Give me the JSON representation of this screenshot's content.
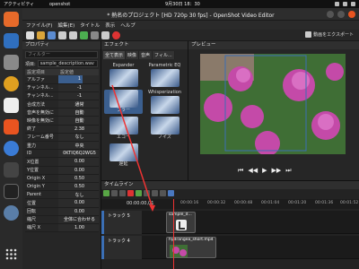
{
  "system": {
    "activities": "アクティビティ",
    "app_name": "openshot",
    "clock": "9月30日 18：30"
  },
  "window": {
    "title": "* 熱名のプロジェクト [HD 720p 30 fps] - OpenShot Video Editor",
    "menus": [
      "ファイル(F)",
      "編集(E)",
      "タイトル",
      "表示",
      "ヘルプ"
    ]
  },
  "toolbar": {
    "export_label": "動画をエクスポート"
  },
  "properties": {
    "title": "プロパティ",
    "filter_placeholder": "フィルター",
    "selector_label": "項目:",
    "selector_value": "sample_description.wav",
    "columns": [
      "設定項目",
      "設定値"
    ],
    "rows": [
      {
        "name": "アルファ",
        "value": "1"
      },
      {
        "name": "チャンネル...",
        "value": "-1"
      },
      {
        "name": "チャンネル...",
        "value": "-1"
      },
      {
        "name": "合成方法",
        "value": "通常"
      },
      {
        "name": "音声を無効に",
        "value": "自動"
      },
      {
        "name": "映像を無効に",
        "value": "自動"
      },
      {
        "name": "終了",
        "value": "2.38"
      },
      {
        "name": "フレーム番号",
        "value": "なし"
      },
      {
        "name": "重力",
        "value": "中央"
      },
      {
        "name": "ID",
        "value": "0KTIQ6Q2WG5"
      },
      {
        "name": "X位置",
        "value": "0.00"
      },
      {
        "name": "Y位置",
        "value": "0.00"
      },
      {
        "name": "Origin X",
        "value": "0.50"
      },
      {
        "name": "Origin Y",
        "value": "0.50"
      },
      {
        "name": "Parent",
        "value": "なし"
      },
      {
        "name": "位置",
        "value": "0.00"
      },
      {
        "name": "回転",
        "value": "0.00"
      },
      {
        "name": "縮尺",
        "value": "全体に合わせる"
      },
      {
        "name": "縮尺 X",
        "value": "1.00"
      }
    ]
  },
  "effects": {
    "title": "エフェクト",
    "tabs": [
      "全て表示",
      "映像",
      "音声",
      "フィル..."
    ],
    "items": [
      {
        "label": "Expander"
      },
      {
        "label": "Parametric EQ"
      },
      {
        "label": "Whisperization"
      },
      {
        "label": "ブラー"
      },
      {
        "label": "エコー"
      },
      {
        "label": "ノイズ"
      },
      {
        "label": "遅延"
      }
    ]
  },
  "preview": {
    "title": "プレビュー",
    "controls": [
      "⏮",
      "◀◀",
      "▶",
      "▶▶",
      "⏭"
    ]
  },
  "timeline": {
    "title": "タイムライン",
    "timecode": "00:00:00,01",
    "ticks": [
      "00:00:16",
      "00:00:32",
      "00:00:48",
      "00:01:04",
      "00:01:20",
      "00:01:36",
      "00:01:52"
    ],
    "tracks": [
      {
        "name": "トラック 5",
        "clip": "sample_d..."
      },
      {
        "name": "トラック 4",
        "clip": "hydrangea_short.mp4"
      }
    ]
  },
  "colors": {
    "accent": "#3b6fb5",
    "ubuntu_orange": "#e95420",
    "playhead": "#e33333"
  }
}
